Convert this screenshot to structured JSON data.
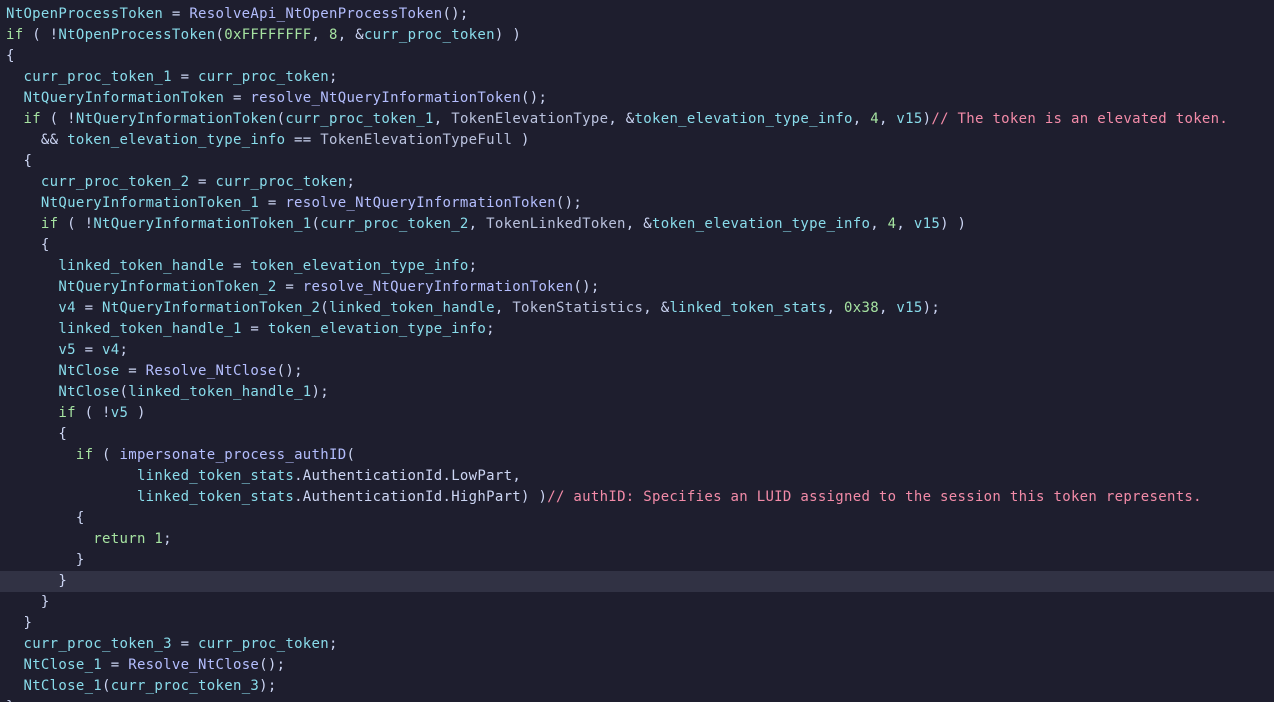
{
  "theme": {
    "background": "#1e1e2e",
    "current_line": "#313244",
    "variable": "#89dceb",
    "function": "#b4befe",
    "keyword": "#a6e3a1",
    "number": "#a6e3a1",
    "punctuation": "#cdd6f4",
    "comment": "#f38ba8"
  },
  "current_line_index": 27,
  "lines": [
    [
      {
        "t": "var",
        "v": "NtOpenProcessToken"
      },
      {
        "t": "pun",
        "v": " = "
      },
      {
        "t": "fn",
        "v": "ResolveApi_NtOpenProcessToken"
      },
      {
        "t": "pun",
        "v": "();"
      }
    ],
    [
      {
        "t": "kw",
        "v": "if"
      },
      {
        "t": "pun",
        "v": " ( !"
      },
      {
        "t": "var",
        "v": "NtOpenProcessToken"
      },
      {
        "t": "pun",
        "v": "("
      },
      {
        "t": "num",
        "v": "0xFFFFFFFF"
      },
      {
        "t": "pun",
        "v": ", "
      },
      {
        "t": "num",
        "v": "8"
      },
      {
        "t": "pun",
        "v": ", &"
      },
      {
        "t": "var",
        "v": "curr_proc_token"
      },
      {
        "t": "pun",
        "v": ") )"
      }
    ],
    [
      {
        "t": "pun",
        "v": "{"
      }
    ],
    [
      {
        "t": "pun",
        "v": "  "
      },
      {
        "t": "var",
        "v": "curr_proc_token_1"
      },
      {
        "t": "pun",
        "v": " = "
      },
      {
        "t": "var",
        "v": "curr_proc_token"
      },
      {
        "t": "pun",
        "v": ";"
      }
    ],
    [
      {
        "t": "pun",
        "v": "  "
      },
      {
        "t": "var",
        "v": "NtQueryInformationToken"
      },
      {
        "t": "pun",
        "v": " = "
      },
      {
        "t": "fn",
        "v": "resolve_NtQueryInformationToken"
      },
      {
        "t": "pun",
        "v": "();"
      }
    ],
    [
      {
        "t": "pun",
        "v": "  "
      },
      {
        "t": "kw",
        "v": "if"
      },
      {
        "t": "pun",
        "v": " ( !"
      },
      {
        "t": "var",
        "v": "NtQueryInformationToken"
      },
      {
        "t": "pun",
        "v": "("
      },
      {
        "t": "var",
        "v": "curr_proc_token_1"
      },
      {
        "t": "pun",
        "v": ", "
      },
      {
        "t": "plain",
        "v": "TokenElevationType"
      },
      {
        "t": "pun",
        "v": ", &"
      },
      {
        "t": "var",
        "v": "token_elevation_type_info"
      },
      {
        "t": "pun",
        "v": ", "
      },
      {
        "t": "num",
        "v": "4"
      },
      {
        "t": "pun",
        "v": ", "
      },
      {
        "t": "var",
        "v": "v15"
      },
      {
        "t": "pun",
        "v": ")"
      },
      {
        "t": "cmt",
        "v": "// The token is an elevated token."
      }
    ],
    [
      {
        "t": "pun",
        "v": "    && "
      },
      {
        "t": "var",
        "v": "token_elevation_type_info"
      },
      {
        "t": "pun",
        "v": " == "
      },
      {
        "t": "plain",
        "v": "TokenElevationTypeFull"
      },
      {
        "t": "pun",
        "v": " )"
      }
    ],
    [
      {
        "t": "pun",
        "v": "  {"
      }
    ],
    [
      {
        "t": "pun",
        "v": "    "
      },
      {
        "t": "var",
        "v": "curr_proc_token_2"
      },
      {
        "t": "pun",
        "v": " = "
      },
      {
        "t": "var",
        "v": "curr_proc_token"
      },
      {
        "t": "pun",
        "v": ";"
      }
    ],
    [
      {
        "t": "pun",
        "v": "    "
      },
      {
        "t": "var",
        "v": "NtQueryInformationToken_1"
      },
      {
        "t": "pun",
        "v": " = "
      },
      {
        "t": "fn",
        "v": "resolve_NtQueryInformationToken"
      },
      {
        "t": "pun",
        "v": "();"
      }
    ],
    [
      {
        "t": "pun",
        "v": "    "
      },
      {
        "t": "kw",
        "v": "if"
      },
      {
        "t": "pun",
        "v": " ( !"
      },
      {
        "t": "var",
        "v": "NtQueryInformationToken_1"
      },
      {
        "t": "pun",
        "v": "("
      },
      {
        "t": "var",
        "v": "curr_proc_token_2"
      },
      {
        "t": "pun",
        "v": ", "
      },
      {
        "t": "plain",
        "v": "TokenLinkedToken"
      },
      {
        "t": "pun",
        "v": ", &"
      },
      {
        "t": "var",
        "v": "token_elevation_type_info"
      },
      {
        "t": "pun",
        "v": ", "
      },
      {
        "t": "num",
        "v": "4"
      },
      {
        "t": "pun",
        "v": ", "
      },
      {
        "t": "var",
        "v": "v15"
      },
      {
        "t": "pun",
        "v": ") )"
      }
    ],
    [
      {
        "t": "pun",
        "v": "    {"
      }
    ],
    [
      {
        "t": "pun",
        "v": "      "
      },
      {
        "t": "var",
        "v": "linked_token_handle"
      },
      {
        "t": "pun",
        "v": " = "
      },
      {
        "t": "var",
        "v": "token_elevation_type_info"
      },
      {
        "t": "pun",
        "v": ";"
      }
    ],
    [
      {
        "t": "pun",
        "v": "      "
      },
      {
        "t": "var",
        "v": "NtQueryInformationToken_2"
      },
      {
        "t": "pun",
        "v": " = "
      },
      {
        "t": "fn",
        "v": "resolve_NtQueryInformationToken"
      },
      {
        "t": "pun",
        "v": "();"
      }
    ],
    [
      {
        "t": "pun",
        "v": "      "
      },
      {
        "t": "var",
        "v": "v4"
      },
      {
        "t": "pun",
        "v": " = "
      },
      {
        "t": "var",
        "v": "NtQueryInformationToken_2"
      },
      {
        "t": "pun",
        "v": "("
      },
      {
        "t": "var",
        "v": "linked_token_handle"
      },
      {
        "t": "pun",
        "v": ", "
      },
      {
        "t": "plain",
        "v": "TokenStatistics"
      },
      {
        "t": "pun",
        "v": ", &"
      },
      {
        "t": "var",
        "v": "linked_token_stats"
      },
      {
        "t": "pun",
        "v": ", "
      },
      {
        "t": "num",
        "v": "0x38"
      },
      {
        "t": "pun",
        "v": ", "
      },
      {
        "t": "var",
        "v": "v15"
      },
      {
        "t": "pun",
        "v": ");"
      }
    ],
    [
      {
        "t": "pun",
        "v": "      "
      },
      {
        "t": "var",
        "v": "linked_token_handle_1"
      },
      {
        "t": "pun",
        "v": " = "
      },
      {
        "t": "var",
        "v": "token_elevation_type_info"
      },
      {
        "t": "pun",
        "v": ";"
      }
    ],
    [
      {
        "t": "pun",
        "v": "      "
      },
      {
        "t": "var",
        "v": "v5"
      },
      {
        "t": "pun",
        "v": " = "
      },
      {
        "t": "var",
        "v": "v4"
      },
      {
        "t": "pun",
        "v": ";"
      }
    ],
    [
      {
        "t": "pun",
        "v": "      "
      },
      {
        "t": "var",
        "v": "NtClose"
      },
      {
        "t": "pun",
        "v": " = "
      },
      {
        "t": "fn",
        "v": "Resolve_NtClose"
      },
      {
        "t": "pun",
        "v": "();"
      }
    ],
    [
      {
        "t": "pun",
        "v": "      "
      },
      {
        "t": "var",
        "v": "NtClose"
      },
      {
        "t": "pun",
        "v": "("
      },
      {
        "t": "var",
        "v": "linked_token_handle_1"
      },
      {
        "t": "pun",
        "v": ");"
      }
    ],
    [
      {
        "t": "pun",
        "v": "      "
      },
      {
        "t": "kw",
        "v": "if"
      },
      {
        "t": "pun",
        "v": " ( !"
      },
      {
        "t": "var",
        "v": "v5"
      },
      {
        "t": "pun",
        "v": " )"
      }
    ],
    [
      {
        "t": "pun",
        "v": "      {"
      }
    ],
    [
      {
        "t": "pun",
        "v": "        "
      },
      {
        "t": "kw",
        "v": "if"
      },
      {
        "t": "pun",
        "v": " ( "
      },
      {
        "t": "fn",
        "v": "impersonate_process_authID"
      },
      {
        "t": "pun",
        "v": "("
      }
    ],
    [
      {
        "t": "pun",
        "v": "               "
      },
      {
        "t": "var",
        "v": "linked_token_stats"
      },
      {
        "t": "pun",
        "v": "."
      },
      {
        "t": "fld",
        "v": "AuthenticationId"
      },
      {
        "t": "pun",
        "v": "."
      },
      {
        "t": "fld",
        "v": "LowPart"
      },
      {
        "t": "pun",
        "v": ","
      }
    ],
    [
      {
        "t": "pun",
        "v": "               "
      },
      {
        "t": "var",
        "v": "linked_token_stats"
      },
      {
        "t": "pun",
        "v": "."
      },
      {
        "t": "fld",
        "v": "AuthenticationId"
      },
      {
        "t": "pun",
        "v": "."
      },
      {
        "t": "fld",
        "v": "HighPart"
      },
      {
        "t": "pun",
        "v": ") )"
      },
      {
        "t": "cmt",
        "v": "// authID: Specifies an LUID assigned to the session this token represents."
      }
    ],
    [
      {
        "t": "pun",
        "v": "        {"
      }
    ],
    [
      {
        "t": "pun",
        "v": "          "
      },
      {
        "t": "kw",
        "v": "return"
      },
      {
        "t": "pun",
        "v": " "
      },
      {
        "t": "num",
        "v": "1"
      },
      {
        "t": "pun",
        "v": ";"
      }
    ],
    [
      {
        "t": "pun",
        "v": "        }"
      }
    ],
    [
      {
        "t": "pun",
        "v": "      }"
      }
    ],
    [
      {
        "t": "pun",
        "v": "    }"
      }
    ],
    [
      {
        "t": "pun",
        "v": "  }"
      }
    ],
    [
      {
        "t": "pun",
        "v": "  "
      },
      {
        "t": "var",
        "v": "curr_proc_token_3"
      },
      {
        "t": "pun",
        "v": " = "
      },
      {
        "t": "var",
        "v": "curr_proc_token"
      },
      {
        "t": "pun",
        "v": ";"
      }
    ],
    [
      {
        "t": "pun",
        "v": "  "
      },
      {
        "t": "var",
        "v": "NtClose_1"
      },
      {
        "t": "pun",
        "v": " = "
      },
      {
        "t": "fn",
        "v": "Resolve_NtClose"
      },
      {
        "t": "pun",
        "v": "();"
      }
    ],
    [
      {
        "t": "pun",
        "v": "  "
      },
      {
        "t": "var",
        "v": "NtClose_1"
      },
      {
        "t": "pun",
        "v": "("
      },
      {
        "t": "var",
        "v": "curr_proc_token_3"
      },
      {
        "t": "pun",
        "v": ");"
      }
    ],
    [
      {
        "t": "pun",
        "v": "}"
      }
    ]
  ]
}
